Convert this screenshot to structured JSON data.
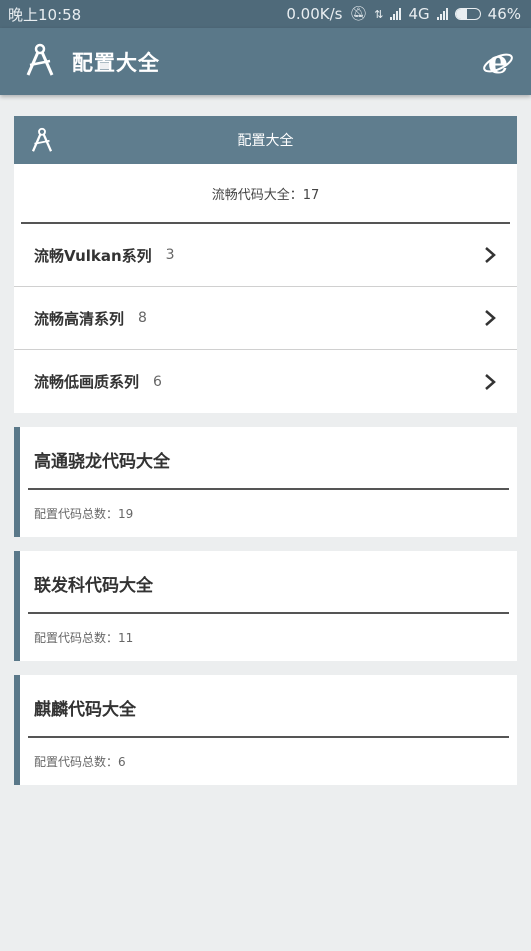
{
  "status_bar": {
    "time": "晚上10:58",
    "speed": "0.00K/s",
    "network": "4G",
    "battery": "46%",
    "battery_level": 0.46
  },
  "app_bar": {
    "title": "配置大全",
    "logo_icon": "compass-icon",
    "browser_icon": "ie-browser-icon"
  },
  "summary_card": {
    "header_title": "配置大全",
    "summary": "流畅代码大全：17",
    "series": [
      {
        "name": "流畅Vulkan系列",
        "count": "3"
      },
      {
        "name": "流畅高清系列",
        "count": "8"
      },
      {
        "name": "流畅低画质系列",
        "count": "6"
      }
    ]
  },
  "groups": [
    {
      "title": "高通骁龙代码大全",
      "count_label": "配置代码总数：19"
    },
    {
      "title": "联发科代码大全",
      "count_label": "配置代码总数：11"
    },
    {
      "title": "麒麟代码大全",
      "count_label": "配置代码总数：6"
    }
  ],
  "colors": {
    "status_bar": "#4f6a7a",
    "app_bar": "#5a7889",
    "card_header": "#5f7d8e",
    "background": "#eceeef"
  }
}
